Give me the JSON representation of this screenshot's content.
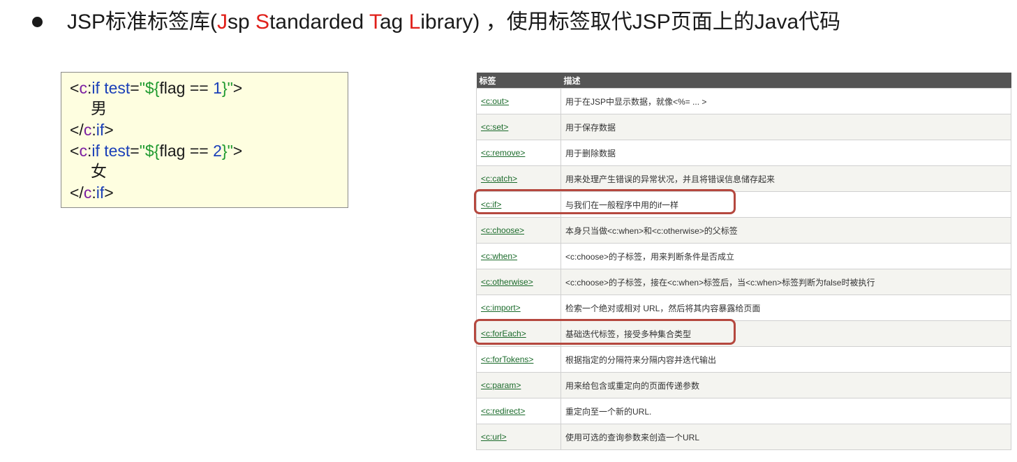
{
  "heading": {
    "prefix": "JSP标准标签库(",
    "j": "J",
    "sp": "sp ",
    "s": "S",
    "tandarded": "tandarded ",
    "t": "T",
    "ag": "ag ",
    "l": "L",
    "ibrary": "ibrary) ",
    "suffix": "，使用标签取代JSP页面上的Java代码"
  },
  "code": {
    "lines": [
      {
        "open": "<",
        "ns": "c",
        "colon": ":",
        "tag": "if ",
        "attr": "test",
        "eq": "=",
        "str1": "\"${",
        "expr": "flag == ",
        "num": "1",
        "str2": "}\"",
        "close": ">"
      },
      {
        "text": "男"
      },
      {
        "open": "</",
        "ns": "c",
        "colon": ":",
        "tag": "if",
        "close": ">"
      },
      {
        "open": "<",
        "ns": "c",
        "colon": ":",
        "tag": "if ",
        "attr": "test",
        "eq": "=",
        "str1": "\"${",
        "expr": "flag == ",
        "num": "2",
        "str2": "}\"",
        "close": ">"
      },
      {
        "text": "女"
      },
      {
        "open": "</",
        "ns": "c",
        "colon": ":",
        "tag": "if",
        "close": ">"
      }
    ]
  },
  "table": {
    "headers": [
      "标签",
      "描述"
    ],
    "rows": [
      {
        "tag": "<c:out>",
        "desc": "用于在JSP中显示数据，就像<%= ... >"
      },
      {
        "tag": "<c:set>",
        "desc": "用于保存数据"
      },
      {
        "tag": "<c:remove>",
        "desc": "用于删除数据"
      },
      {
        "tag": "<c:catch>",
        "desc": "用来处理产生错误的异常状况，并且将错误信息储存起来"
      },
      {
        "tag": "<c:if>",
        "desc": "与我们在一般程序中用的if一样"
      },
      {
        "tag": "<c:choose>",
        "desc": "本身只当做<c:when>和<c:otherwise>的父标签"
      },
      {
        "tag": "<c:when>",
        "desc": "<c:choose>的子标签，用来判断条件是否成立"
      },
      {
        "tag": "<c:otherwise>",
        "desc": "<c:choose>的子标签，接在<c:when>标签后，当<c:when>标签判断为false时被执行"
      },
      {
        "tag": "<c:import>",
        "desc": "检索一个绝对或相对 URL，然后将其内容暴露给页面"
      },
      {
        "tag": "<c:forEach>",
        "desc": "基础迭代标签，接受多种集合类型"
      },
      {
        "tag": "<c:forTokens>",
        "desc": "根据指定的分隔符来分隔内容并迭代输出"
      },
      {
        "tag": "<c:param>",
        "desc": "用来给包含或重定向的页面传递参数"
      },
      {
        "tag": "<c:redirect>",
        "desc": "重定向至一个新的URL."
      },
      {
        "tag": "<c:url>",
        "desc": "使用可选的查询参数来创造一个URL"
      }
    ],
    "highlighted_tags": [
      "<c:if>",
      "<c:forEach>"
    ]
  },
  "colors": {
    "accent_red": "#e0201a",
    "highlight_border": "#b5483f",
    "link_green": "#1a6a2a",
    "code_box_bg": "#fefee0",
    "table_header_bg": "#555555"
  }
}
